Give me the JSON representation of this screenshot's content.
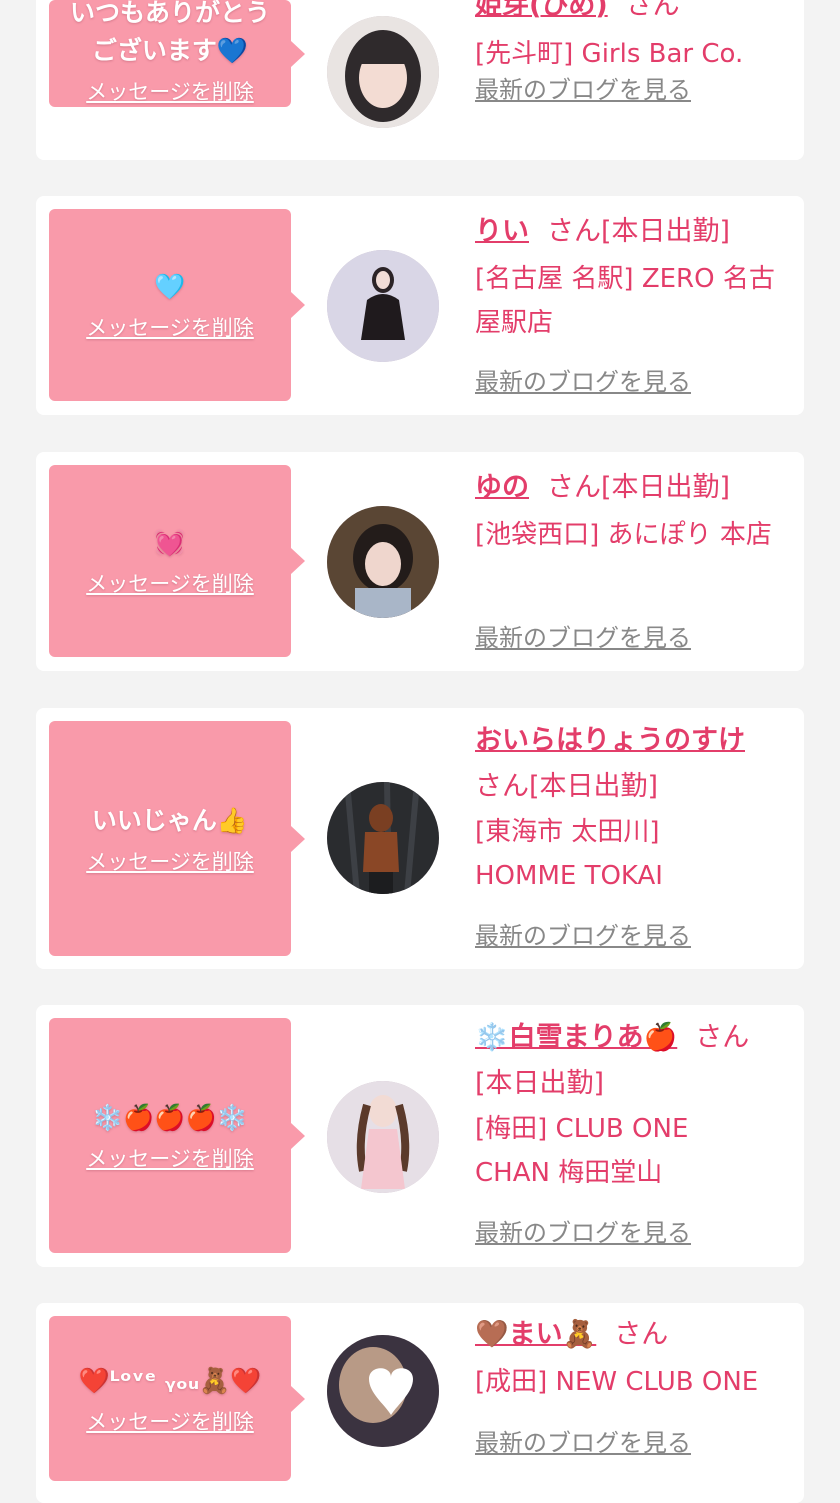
{
  "delete_label": "メッセージを削除",
  "blog_label": "最新のブログを見る",
  "honorific": "さん",
  "colors": {
    "bubble": "#f99aaa",
    "accent": "#e33d6a",
    "link_gray": "#888888",
    "background": "#f3f3f3"
  },
  "cards": [
    {
      "message": "いつもありがとう\nございます💙",
      "girl_name": "姫芽(ひめ)",
      "status": "",
      "shop": "[先斗町] Girls Bar Co."
    },
    {
      "message": "🩵",
      "girl_name": "りい",
      "status": "[本日出勤]",
      "shop": "[名古屋 名駅] ZERO 名古屋駅店"
    },
    {
      "message": "💓",
      "girl_name": "ゆの",
      "status": "[本日出勤]",
      "shop": "[池袋西口] あにぽり 本店"
    },
    {
      "message": "いいじゃん👍",
      "girl_name": "おいらはりょうのすけ",
      "status": "[本日出勤]",
      "shop": "[東海市 太田川] HOMME TOKAI"
    },
    {
      "message": "❄️🍎🍎🍎❄️",
      "girl_name": "❄️白雪まりあ🍎",
      "status": "[本日出勤]",
      "shop": "[梅田] CLUB ONE CHAN 梅田堂山"
    },
    {
      "message": "❤️ᴸᵒᵛᵉ ᵧₒᵤ🧸❤️",
      "girl_name": "🤎まい🧸",
      "status": "",
      "shop": "[成田] NEW CLUB ONE"
    }
  ]
}
